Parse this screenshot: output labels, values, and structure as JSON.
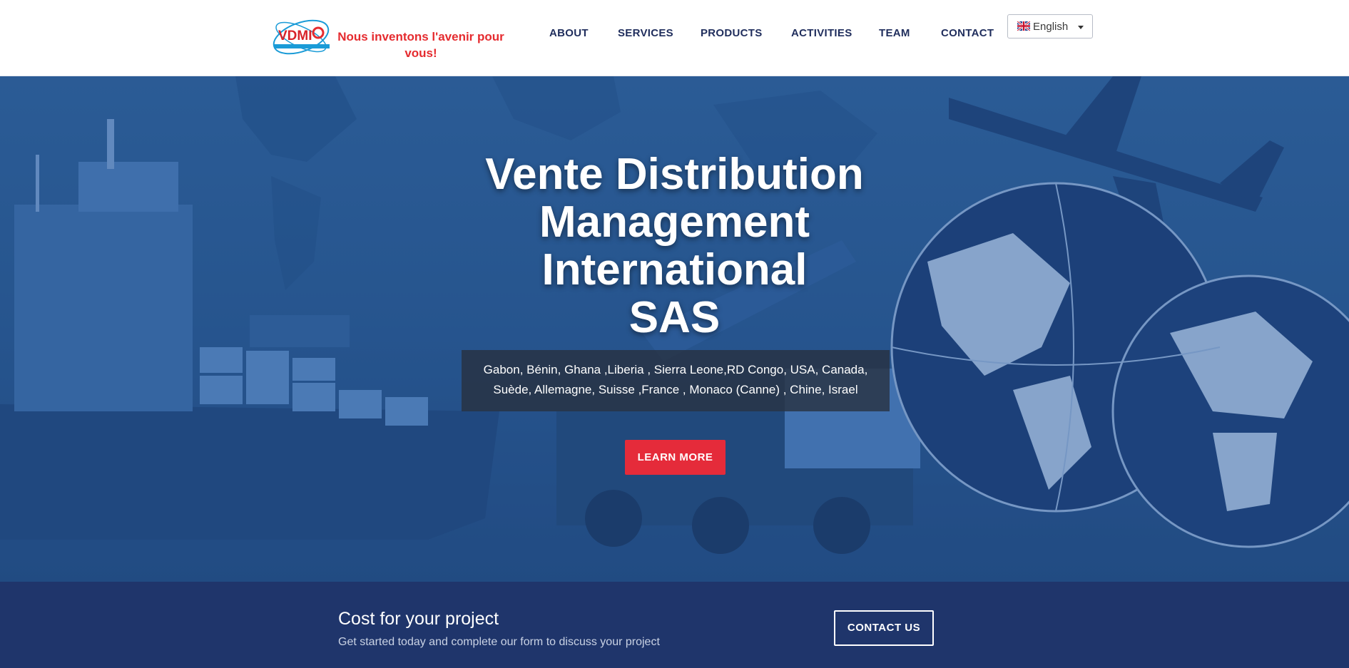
{
  "header": {
    "logo_text": "VDMI",
    "tagline": "Nous inventons l'avenir pour vous!",
    "nav": [
      "ABOUT",
      "SERVICES",
      "PRODUCTS",
      "ACTIVITIES",
      "TEAM",
      "CONTACT"
    ],
    "language": {
      "selected": "English",
      "flag_icon": "uk-flag-icon"
    }
  },
  "hero": {
    "title_lines": [
      "Vente Distribution",
      "Management",
      "International",
      "SAS"
    ],
    "countries": "Gabon, Bénin, Ghana ,Liberia , Sierra Leone,RD Congo, USA, Canada, Suède, Allemagne, Suisse ,France , Monaco (Canne) , Chine, Israel",
    "button_label": "LEARN MORE"
  },
  "cta": {
    "title": "Cost for your project",
    "subtitle": "Get started today and complete our form to discuss your project",
    "button_label": "CONTACT US"
  },
  "colors": {
    "brand_red": "#e52b3a",
    "nav_text": "#1f2d5c",
    "cta_bg": "#1f356b",
    "hero_blue": "#25548c"
  }
}
